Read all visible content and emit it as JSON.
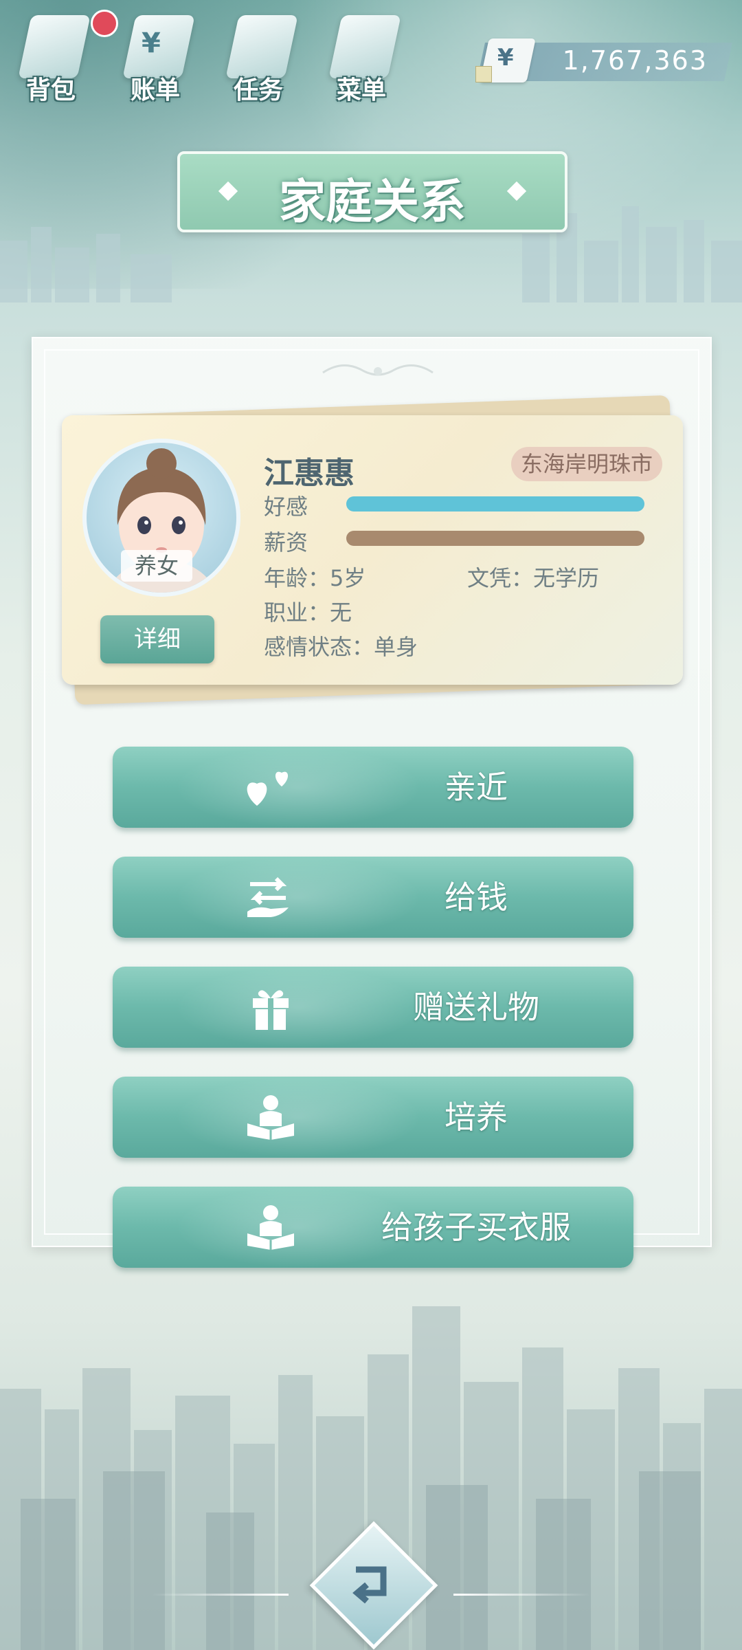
{
  "topbar": {
    "items": [
      {
        "label": "背包",
        "icon": "bag-icon",
        "badge": true
      },
      {
        "label": "账单",
        "icon": "bill-icon",
        "badge": false
      },
      {
        "label": "任务",
        "icon": "task-icon",
        "badge": false
      },
      {
        "label": "菜单",
        "icon": "menu-icon",
        "badge": false
      }
    ],
    "currency_symbol": "¥",
    "money": "1,767,363"
  },
  "title": "家庭关系",
  "card": {
    "name": "江惠惠",
    "city": "东海岸明珠市",
    "relation": "养女",
    "detail_button": "详细",
    "favor_label": "好感",
    "favor_level": 1.0,
    "salary_label": "薪资",
    "salary_level": 1.0,
    "age": "年龄：5岁",
    "education": "文凭：无学历",
    "job": "职业：无",
    "relationship_status": "感情状态：单身",
    "colors": {
      "favor": "#5fc3d8",
      "salary": "#a88a6e"
    }
  },
  "actions": [
    {
      "label": "亲近",
      "icon": "hearts-icon"
    },
    {
      "label": "给钱",
      "icon": "give-money-icon"
    },
    {
      "label": "赠送礼物",
      "icon": "gift-icon"
    },
    {
      "label": "培养",
      "icon": "reading-child-icon"
    },
    {
      "label": "给孩子买衣服",
      "icon": "reading-child-icon"
    }
  ]
}
